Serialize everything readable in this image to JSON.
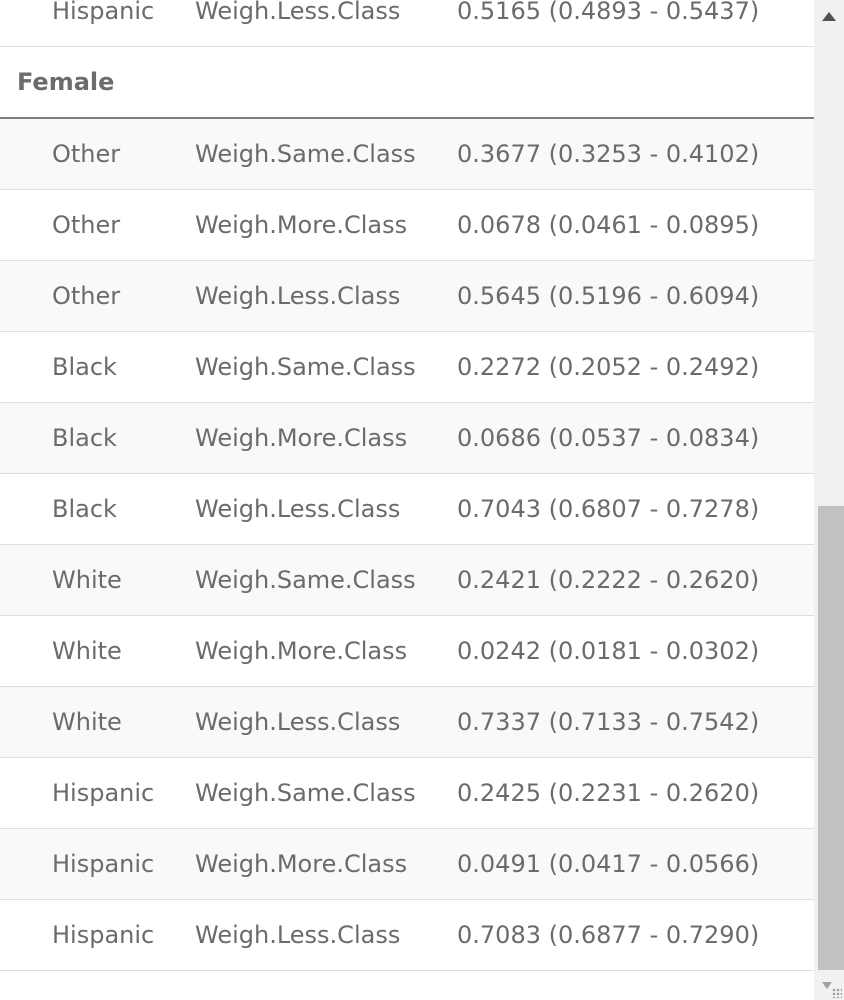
{
  "table": {
    "top_row": {
      "group": "Hispanic",
      "comparison": "Weigh.Less.Class",
      "estimate": "0.5165 (0.4893 - 0.5437)"
    },
    "group_header": "Female",
    "rows": [
      {
        "group": "Other",
        "comparison": "Weigh.Same.Class",
        "estimate": "0.3677 (0.3253 - 0.4102)"
      },
      {
        "group": "Other",
        "comparison": "Weigh.More.Class",
        "estimate": "0.0678 (0.0461 - 0.0895)"
      },
      {
        "group": "Other",
        "comparison": "Weigh.Less.Class",
        "estimate": "0.5645 (0.5196 - 0.6094)"
      },
      {
        "group": "Black",
        "comparison": "Weigh.Same.Class",
        "estimate": "0.2272 (0.2052 - 0.2492)"
      },
      {
        "group": "Black",
        "comparison": "Weigh.More.Class",
        "estimate": "0.0686 (0.0537 - 0.0834)"
      },
      {
        "group": "Black",
        "comparison": "Weigh.Less.Class",
        "estimate": "0.7043 (0.6807 - 0.7278)"
      },
      {
        "group": "White",
        "comparison": "Weigh.Same.Class",
        "estimate": "0.2421 (0.2222 - 0.2620)"
      },
      {
        "group": "White",
        "comparison": "Weigh.More.Class",
        "estimate": "0.0242 (0.0181 - 0.0302)"
      },
      {
        "group": "White",
        "comparison": "Weigh.Less.Class",
        "estimate": "0.7337 (0.7133 - 0.7542)"
      },
      {
        "group": "Hispanic",
        "comparison": "Weigh.Same.Class",
        "estimate": "0.2425 (0.2231 - 0.2620)"
      },
      {
        "group": "Hispanic",
        "comparison": "Weigh.More.Class",
        "estimate": "0.0491 (0.0417 - 0.0566)"
      },
      {
        "group": "Hispanic",
        "comparison": "Weigh.Less.Class",
        "estimate": "0.7083 (0.6877 - 0.7290)"
      }
    ]
  },
  "scrollbar": {
    "position_fraction": 0.52
  },
  "icons": {
    "scroll_up": "triangle-up-icon",
    "scroll_down": "triangle-down-icon",
    "resize": "resize-grip-icon"
  },
  "colors": {
    "text": "#6b6b6b",
    "row_alt": "#f9f9f9",
    "divider": "#dedede",
    "thumb": "#c1c1c1"
  }
}
